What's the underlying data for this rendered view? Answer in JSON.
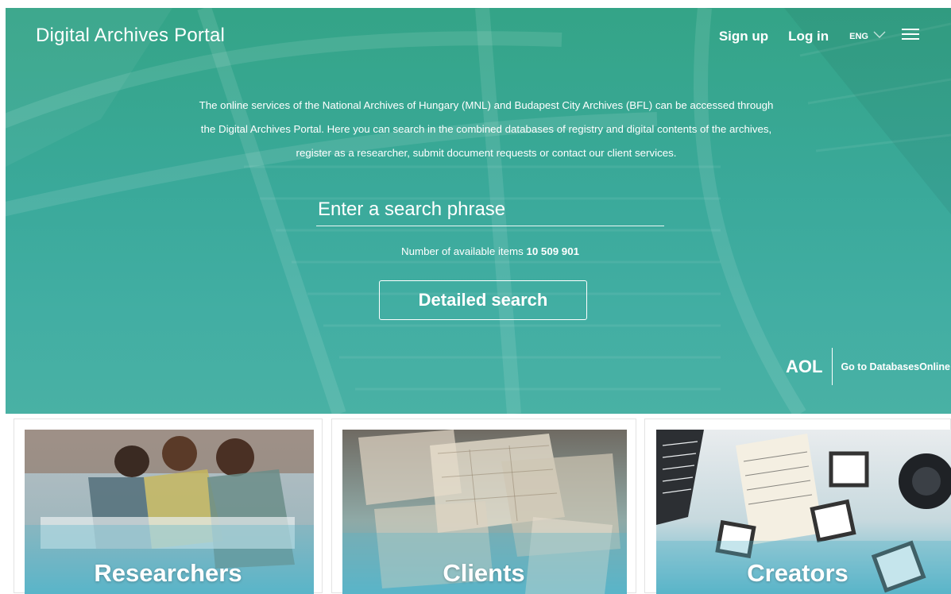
{
  "header": {
    "title": "Digital Archives Portal",
    "signup": "Sign up",
    "login": "Log in",
    "language": "ENG"
  },
  "intro": {
    "line1": "The online services of the National Archives of Hungary (MNL) and Budapest City Archives (BFL) can be accessed through",
    "line2": "the Digital Archives Portal. Here you can search in the combined databases of registry and digital contents of the archives,",
    "line3": "register as a researcher, submit document requests or contact our client services."
  },
  "search": {
    "placeholder": "Enter a search phrase",
    "count_label": "Number of available items",
    "count_value": "10 509 901",
    "detailed_button": "Detailed search"
  },
  "aol": {
    "mark": "AOL",
    "link": "Go to DatabasesOnline"
  },
  "cards": [
    {
      "label": "Researchers"
    },
    {
      "label": "Clients"
    },
    {
      "label": "Creators"
    }
  ],
  "colors": {
    "accent": "#3aa99a",
    "hero_top": "#34a487",
    "hero_bottom": "#49b1a4",
    "text_on_accent": "#ffffff"
  },
  "icons": {
    "language_dropdown": "chevron-down-icon",
    "menu": "hamburger-menu-icon"
  }
}
